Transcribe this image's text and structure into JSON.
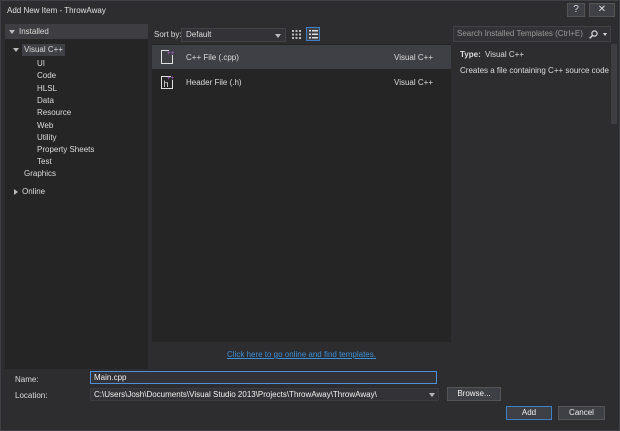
{
  "window": {
    "title": "Add New Item - ThrowAway",
    "help": "?",
    "close": "✕"
  },
  "tree": {
    "header": "Installed",
    "root": "Visual C++",
    "children": [
      "UI",
      "Code",
      "HLSL",
      "Data",
      "Resource",
      "Web",
      "Utility",
      "Property Sheets",
      "Test"
    ],
    "graphics": "Graphics",
    "online": "Online"
  },
  "sort": {
    "label": "Sort by:",
    "value": "Default"
  },
  "templates": [
    {
      "name": "C++ File (.cpp)",
      "lang": "Visual C++",
      "icon": "cpp-file-icon"
    },
    {
      "name": "Header File (.h)",
      "lang": "Visual C++",
      "icon": "header-file-icon"
    }
  ],
  "online_link": "Click here to go online and find templates.",
  "search": {
    "placeholder": "Search Installed Templates (Ctrl+E)"
  },
  "details": {
    "type_label": "Type:",
    "type_value": "Visual C++",
    "description": "Creates a file containing C++ source code"
  },
  "form": {
    "name_label": "Name:",
    "name_value": "Main.cpp",
    "location_label": "Location:",
    "location_value": "C:\\Users\\Josh\\Documents\\Visual Studio 2013\\Projects\\ThrowAway\\ThrowAway\\",
    "browse": "Browse...",
    "add": "Add",
    "cancel": "Cancel"
  },
  "colors": {
    "accent": "#3e80c8",
    "link": "#3c8fd6",
    "icon_badge": "#c563e8"
  }
}
